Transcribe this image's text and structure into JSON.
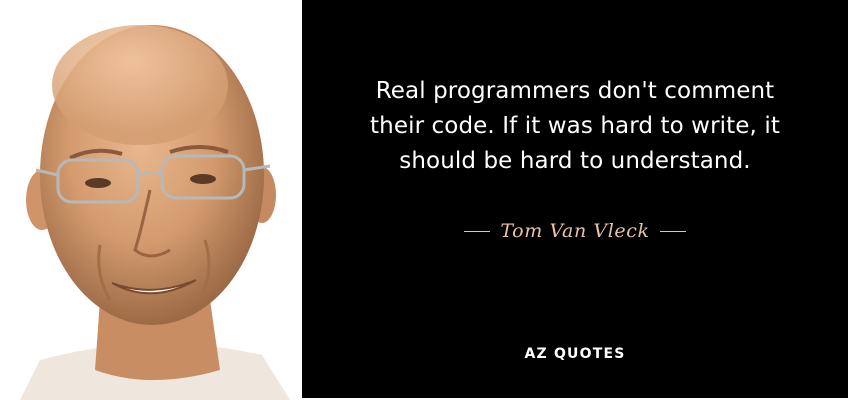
{
  "quote": {
    "lines": [
      "Real programmers don't comment",
      "their code. If it was hard to write, it",
      "should be hard to understand."
    ],
    "author": "Tom Van Vleck"
  },
  "brand": {
    "logo_text": "AZ QUOTES"
  },
  "photo": {
    "icon": "portrait-photo"
  },
  "colors": {
    "panel_background": "#000000",
    "quote_text": "#ffffff",
    "author_accent": "#e7c4a4"
  }
}
